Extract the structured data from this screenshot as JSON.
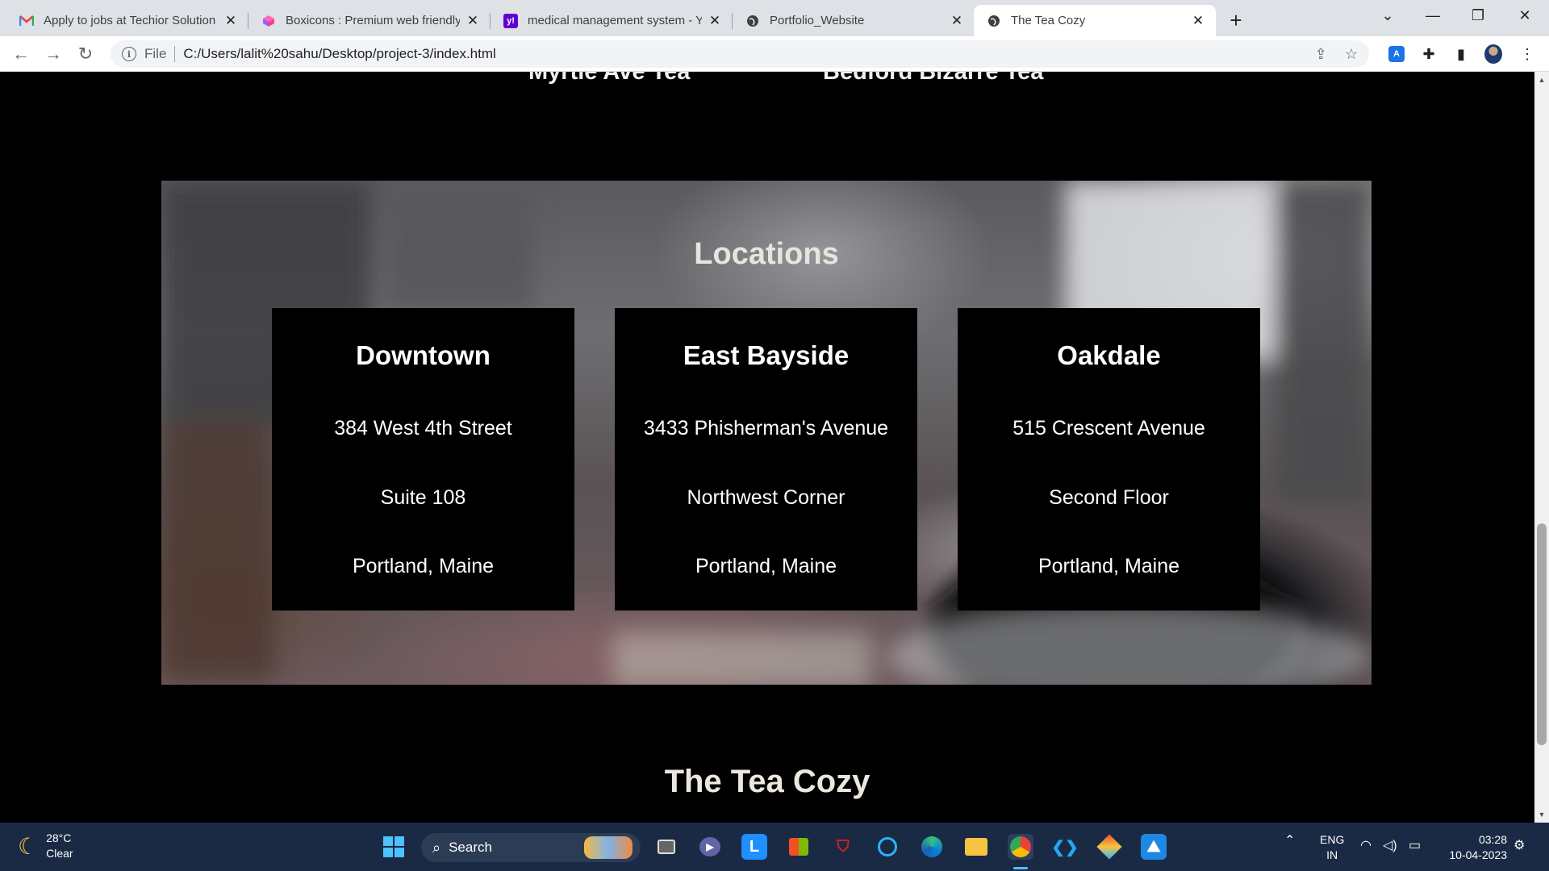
{
  "browser": {
    "tabs": [
      {
        "title": "Apply to jobs at Techior Solution",
        "icon": "gmail-icon",
        "active": false
      },
      {
        "title": "Boxicons : Premium web friendly",
        "icon": "boxicons-icon",
        "active": false
      },
      {
        "title": "medical management system - Yo",
        "icon": "yahoo-icon",
        "active": false
      },
      {
        "title": "Portfolio_Website",
        "icon": "globe-icon",
        "active": false
      },
      {
        "title": "The Tea Cozy",
        "icon": "globe-icon",
        "active": true
      }
    ],
    "address": {
      "scheme": "File",
      "url": "C:/Users/lalit%20sahu/Desktop/project-3/index.html"
    }
  },
  "page": {
    "previous_section": {
      "titles": [
        "Myrtle Ave Tea",
        "Bedford Bizarre Tea"
      ]
    },
    "locations": {
      "heading": "Locations",
      "cards": [
        {
          "name": "Downtown",
          "line1": "384 West 4th Street",
          "line2": "Suite 108",
          "line3": "Portland, Maine"
        },
        {
          "name": "East Bayside",
          "line1": "3433 Phisherman's Avenue",
          "line2": "Northwest Corner",
          "line3": "Portland, Maine"
        },
        {
          "name": "Oakdale",
          "line1": "515 Crescent Avenue",
          "line2": "Second Floor",
          "line3": "Portland, Maine"
        }
      ]
    },
    "footer": {
      "title": "The Tea Cozy"
    }
  },
  "taskbar": {
    "weather": {
      "temp": "28°C",
      "condition": "Clear"
    },
    "search_label": "Search",
    "language": {
      "line1": "ENG",
      "line2": "IN"
    },
    "clock": {
      "time": "03:28",
      "date": "10-04-2023"
    }
  },
  "colors": {
    "page_background": "#000000",
    "card_background": "#000000",
    "heading_text": "#e8e4de",
    "taskbar": "#1a2a44",
    "tab_strip": "#dee1e6"
  }
}
